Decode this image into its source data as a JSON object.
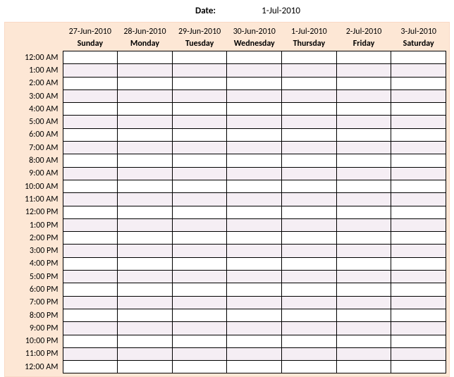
{
  "header": {
    "date_label": "Date:",
    "date_value": "1-Jul-2010"
  },
  "columns": [
    {
      "date": "27-Jun-2010",
      "day": "Sunday"
    },
    {
      "date": "28-Jun-2010",
      "day": "Monday"
    },
    {
      "date": "29-Jun-2010",
      "day": "Tuesday"
    },
    {
      "date": "30-Jun-2010",
      "day": "Wednesday"
    },
    {
      "date": "1-Jul-2010",
      "day": "Thursday"
    },
    {
      "date": "2-Jul-2010",
      "day": "Friday"
    },
    {
      "date": "3-Jul-2010",
      "day": "Saturday"
    }
  ],
  "hours": [
    "12:00 AM",
    "1:00 AM",
    "2:00 AM",
    "3:00 AM",
    "4:00 AM",
    "5:00 AM",
    "6:00 AM",
    "7:00 AM",
    "8:00 AM",
    "9:00 AM",
    "10:00 AM",
    "11:00 AM",
    "12:00 PM",
    "1:00 PM",
    "2:00 PM",
    "3:00 PM",
    "4:00 PM",
    "5:00 PM",
    "6:00 PM",
    "7:00 PM",
    "8:00 PM",
    "9:00 PM",
    "10:00 PM",
    "11:00 PM",
    "12:00 AM"
  ]
}
